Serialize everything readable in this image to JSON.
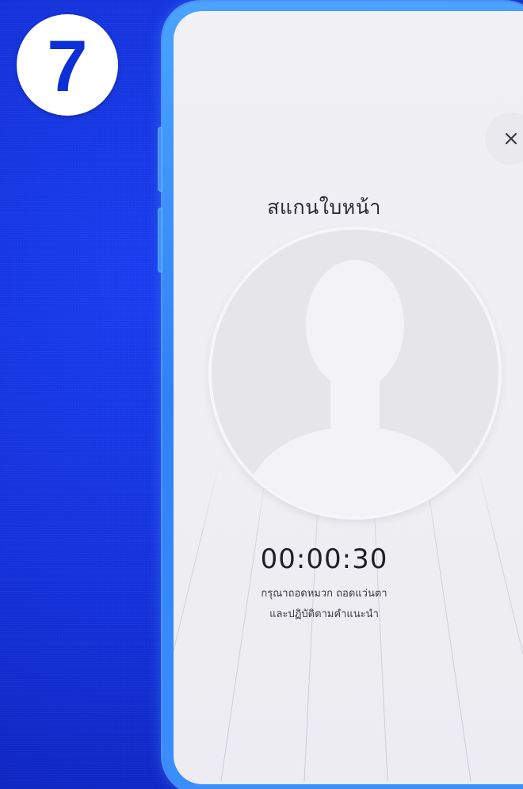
{
  "step": {
    "number": "7"
  },
  "scan": {
    "title": "สแกนใบหน้า",
    "timer": "00:00:30",
    "instruction_line1": "กรุณาถอดหมวก ถอดแว่นตา",
    "instruction_line2": "และปฏิบัติตามคำแนะนำ"
  },
  "icons": {
    "close": "close-icon",
    "face": "person-silhouette-icon"
  },
  "colors": {
    "background": "#1634de",
    "step_number": "#0c2fd6",
    "phone_frame": "#3b8efc",
    "screen": "#efeff3",
    "timer_text": "#1f1f28"
  }
}
